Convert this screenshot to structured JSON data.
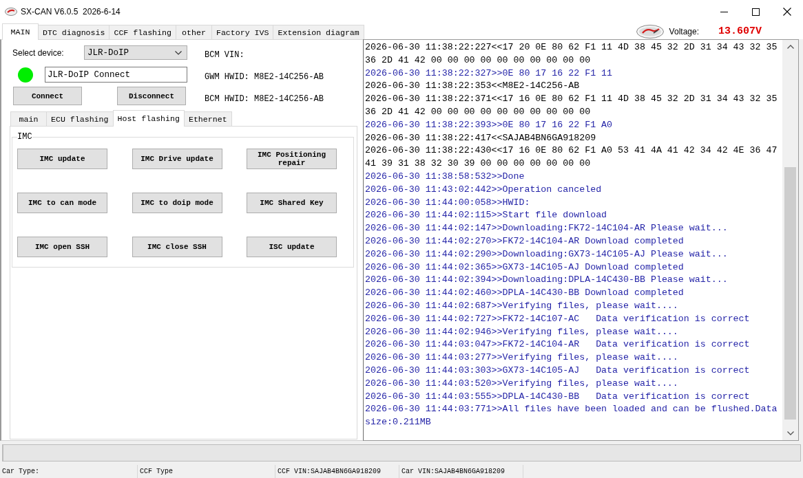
{
  "window": {
    "title": "SX-CAN V6.0.5  2026-6-14"
  },
  "main_tabs": [
    {
      "label": "MAIN",
      "selected": true
    },
    {
      "label": "DTC diagnosis",
      "selected": false
    },
    {
      "label": "CCF flashing",
      "selected": false
    },
    {
      "label": "other",
      "selected": false
    },
    {
      "label": "Factory IVS",
      "selected": false
    },
    {
      "label": "Extension diagram",
      "selected": false
    }
  ],
  "voltage": {
    "label": "Voltage:",
    "value": "13.607V"
  },
  "device": {
    "label": "Select device:",
    "value": "JLR-DoIP",
    "connected": true,
    "connection_field": "JLR-DoIP Connect"
  },
  "connection_buttons": [
    "Connect",
    "Disconnect"
  ],
  "vehicle_info": [
    "BCM VIN:",
    "GWM HWID: M8E2-14C256-AB",
    "BCM HWID: M8E2-14C256-AB"
  ],
  "sub_tabs": [
    {
      "label": "main",
      "selected": false
    },
    {
      "label": "ECU flashing",
      "selected": false
    },
    {
      "label": "Host flashing",
      "selected": true
    },
    {
      "label": "Ethernet",
      "selected": false
    }
  ],
  "group": {
    "title": "IMC",
    "buttons": [
      "IMC update",
      "IMC Drive update",
      "IMC Positioning repair",
      "IMC to can mode",
      "IMC to doip mode",
      "IMC Shared Key",
      "IMC open SSH",
      "IMC close SSH",
      "ISC update"
    ]
  },
  "log": [
    {
      "kind": "received",
      "text": "2026-06-30 11:38:22:227<<17 20 0E 80 62 F1 11 4D 38 45 32 2D 31 34 43 32 35 36 2D 41 42 00 00 00 00 00 00 00 00 00 00"
    },
    {
      "kind": "sent",
      "text": "2026-06-30 11:38:22:327>>0E 80 17 16 22 F1 11"
    },
    {
      "kind": "received",
      "text": "2026-06-30 11:38:22:353<<M8E2-14C256-AB"
    },
    {
      "kind": "received",
      "text": "2026-06-30 11:38:22:371<<17 16 0E 80 62 F1 11 4D 38 45 32 2D 31 34 43 32 35 36 2D 41 42 00 00 00 00 00 00 00 00 00 00"
    },
    {
      "kind": "sent",
      "text": "2026-06-30 11:38:22:393>>0E 80 17 16 22 F1 A0"
    },
    {
      "kind": "received",
      "text": "2026-06-30 11:38:22:417<<SAJAB4BN6GA918209"
    },
    {
      "kind": "received",
      "text": "2026-06-30 11:38:22:430<<17 16 0E 80 62 F1 A0 53 41 4A 41 42 34 42 4E 36 47 41 39 31 38 32 30 39 00 00 00 00 00 00 00"
    },
    {
      "kind": "sent",
      "text": "2026-06-30 11:38:58:532>>Done"
    },
    {
      "kind": "sent",
      "text": "2026-06-30 11:43:02:442>>Operation canceled"
    },
    {
      "kind": "sent",
      "text": "2026-06-30 11:44:00:058>>HWID:"
    },
    {
      "kind": "sent",
      "text": "2026-06-30 11:44:02:115>>Start file download"
    },
    {
      "kind": "sent",
      "text": "2026-06-30 11:44:02:147>>Downloading:FK72-14C104-AR Please wait..."
    },
    {
      "kind": "sent",
      "text": "2026-06-30 11:44:02:270>>FK72-14C104-AR Download completed"
    },
    {
      "kind": "sent",
      "text": "2026-06-30 11:44:02:290>>Downloading:GX73-14C105-AJ Please wait..."
    },
    {
      "kind": "sent",
      "text": "2026-06-30 11:44:02:365>>GX73-14C105-AJ Download completed"
    },
    {
      "kind": "sent",
      "text": "2026-06-30 11:44:02:394>>Downloading:DPLA-14C430-BB Please wait..."
    },
    {
      "kind": "sent",
      "text": "2026-06-30 11:44:02:460>>DPLA-14C430-BB Download completed"
    },
    {
      "kind": "sent",
      "text": "2026-06-30 11:44:02:687>>Verifying files, please wait...."
    },
    {
      "kind": "sent",
      "text": "2026-06-30 11:44:02:727>>FK72-14C107-AC   Data verification is correct"
    },
    {
      "kind": "sent",
      "text": "2026-06-30 11:44:02:946>>Verifying files, please wait...."
    },
    {
      "kind": "sent",
      "text": "2026-06-30 11:44:03:047>>FK72-14C104-AR   Data verification is correct"
    },
    {
      "kind": "sent",
      "text": "2026-06-30 11:44:03:277>>Verifying files, please wait...."
    },
    {
      "kind": "sent",
      "text": "2026-06-30 11:44:03:303>>GX73-14C105-AJ   Data verification is correct"
    },
    {
      "kind": "sent",
      "text": "2026-06-30 11:44:03:520>>Verifying files, please wait...."
    },
    {
      "kind": "sent",
      "text": "2026-06-30 11:44:03:555>>DPLA-14C430-BB   Data verification is correct"
    },
    {
      "kind": "sent",
      "text": "2026-06-30 11:44:03:771>>All files have been loaded and can be flushed.Data size:0.211MB"
    }
  ],
  "progress_bar": {
    "level": 0
  },
  "status_bar": [
    "Car Type:",
    "CCF Type",
    "CCF VIN:SAJAB4BN6GA918209",
    "Car VIN:SAJAB4BN6GA918209"
  ]
}
